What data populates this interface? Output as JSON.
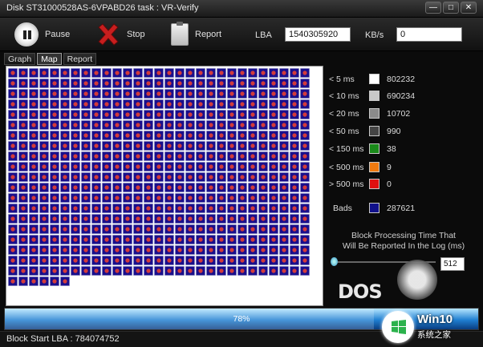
{
  "window": {
    "title": "Disk ST31000528AS-6VPABD26   task : VR-Verify",
    "controls": [
      "—",
      "□",
      "✕"
    ]
  },
  "toolbar": {
    "pause_label": "Pause",
    "stop_label": "Stop",
    "report_label": "Report",
    "lba_label": "LBA",
    "lba_value": "1540305920",
    "kbs_label": "KB/s",
    "kbs_value": "0"
  },
  "tabs": [
    {
      "label": "Graph",
      "active": false
    },
    {
      "label": "Map",
      "active": true
    },
    {
      "label": "Report",
      "active": false
    }
  ],
  "block_map": {
    "block_color": "#1a0f8c",
    "dot_color": "#d23b3b"
  },
  "legend": [
    {
      "label": "< 5 ms",
      "count": "802232",
      "color": "#ffffff"
    },
    {
      "label": "< 10 ms",
      "count": "690234",
      "color": "#c8c8c8"
    },
    {
      "label": "< 20 ms",
      "count": "10702",
      "color": "#8a8a8a"
    },
    {
      "label": "< 50 ms",
      "count": "990",
      "color": "#444444"
    },
    {
      "label": "< 150 ms",
      "count": "38",
      "color": "#1a8a1a"
    },
    {
      "label": "< 500 ms",
      "count": "9",
      "color": "#f07a10"
    },
    {
      "label": "> 500 ms",
      "count": "0",
      "color": "#e01010"
    },
    {
      "label": "Bads",
      "count": "287621",
      "color": "#10108a"
    }
  ],
  "block_note": {
    "line1": "Block Processing Time That",
    "line2": "Will Be Reported In the Log (ms)"
  },
  "slider_value": "512",
  "logo_text": "DOS",
  "progress": {
    "percent": 78,
    "label": "78%"
  },
  "status": {
    "text": "Block Start LBA : 784074752"
  },
  "watermark": {
    "title": "Win10",
    "subtitle": "系统之家",
    "color": "#2bb24c"
  }
}
